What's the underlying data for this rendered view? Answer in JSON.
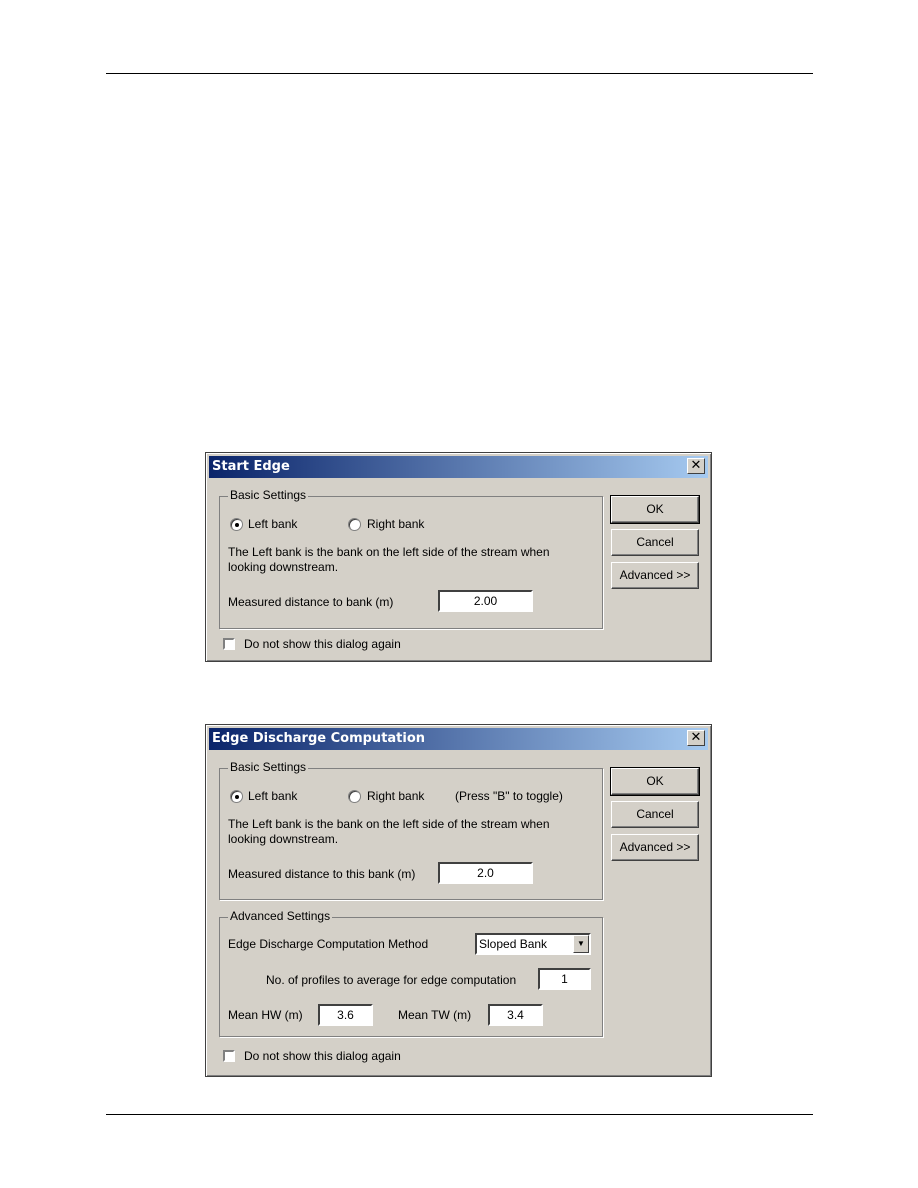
{
  "page": {
    "header_rule": true,
    "footer_rule": true
  },
  "dialog1": {
    "title": "Start Edge",
    "close_glyph": "✕",
    "basic_settings": {
      "legend": "Basic Settings",
      "radio_left": {
        "label": "Left bank",
        "checked": true
      },
      "radio_right": {
        "label": "Right bank",
        "checked": false
      },
      "description_line1": "The Left bank is the bank on the left side of the stream when",
      "description_line2": "looking downstream.",
      "distance_label": "Measured distance to bank (m)",
      "distance_value": "2.00"
    },
    "buttons": {
      "ok": "OK",
      "cancel": "Cancel",
      "advanced": "Advanced >>"
    },
    "dont_show": {
      "label": "Do not show this dialog again",
      "checked": false
    }
  },
  "dialog2": {
    "title": "Edge Discharge Computation",
    "close_glyph": "✕",
    "basic_settings": {
      "legend": "Basic Settings",
      "radio_left": {
        "label": "Left bank",
        "checked": true
      },
      "radio_right": {
        "label": "Right bank",
        "checked": false
      },
      "toggle_hint": "(Press \"B\" to toggle)",
      "description_line1": "The Left bank is the bank on the left side of the stream when",
      "description_line2": "looking downstream.",
      "distance_label": "Measured distance to this bank (m)",
      "distance_value": "2.0"
    },
    "advanced_settings": {
      "legend": "Advanced Settings",
      "method_label": "Edge Discharge Computation Method",
      "method_value": "Sloped Bank",
      "profiles_label": "No. of profiles to average for edge computation",
      "profiles_value": "1",
      "mean_hw_label": "Mean HW (m)",
      "mean_hw_value": "3.6",
      "mean_tw_label": "Mean TW (m)",
      "mean_tw_value": "3.4"
    },
    "buttons": {
      "ok": "OK",
      "cancel": "Cancel",
      "advanced": "Advanced >>"
    },
    "dont_show": {
      "label": "Do not show this dialog again",
      "checked": false
    }
  }
}
